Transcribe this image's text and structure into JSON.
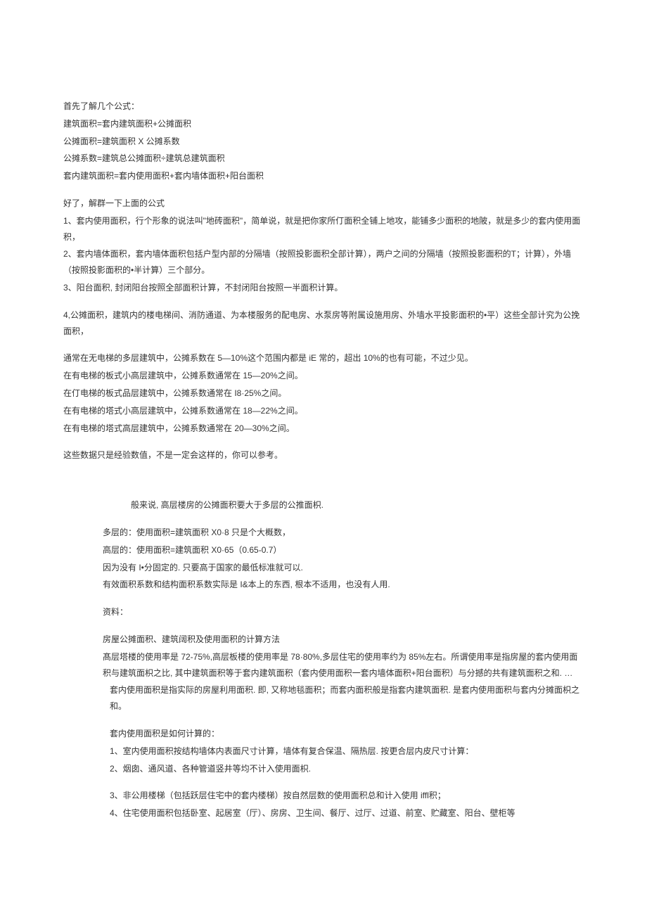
{
  "intro": {
    "line1": "首先了解几个公式：",
    "line2": "建筑面积=套内建筑面积+公摊面积",
    "line3": "公摊面积=建筑面积 X 公摊系数",
    "line4": "公摊系数=建筑总公摊面积÷建筑总建筑面积",
    "line5": "套内建筑面积=套内使用面积+套内墙体面积+阳台面积"
  },
  "explain": {
    "header": "好了，解群一下上面的公式",
    "item1": "1、套内使用面积，行个形象的说法叫\"地砖面积\"，简单说，就是把你家所仃面积全铺上地攻，能铺多少面积的地陂，就是多少的套内使用面积，",
    "item2": "2、套内墙体面积，套内墙体面积包括户型内部的分隔墙（按照投影面积全部计算），两户之间的分隔墙（按照投影面积的T；计算），外墙（按照投影面积的•半计算）三个部分。",
    "item3": "3、阳台面积, 封闭阳台按照全部面积计算，不封闭阳台按照一半面积计算。",
    "item4": "4,公摊面积，建筑内的楼电梯间、消防通道、为本楼服务的配电房、水泵房等附属设施用房、外墙水平投影面积的•平）这些全部计究为公挽面积，"
  },
  "ratios": {
    "r1": "通常在无电梯的多层建筑中，公摊系数在 5—10%这个范围内都是 iE 常的，超出 10%的也有可能，不过少见。",
    "r2": "在有电梯的板式小高层建筑中，公摊系数通常在 15—20%之间。",
    "r3": "在仃电梯的板式品层建筑中，公摊系数通常在 I8·25%之间。",
    "r4": "在有电梯的塔式小高层建筑中，公摊系数通常在 18—22%之间。",
    "r5": "在有电梯的塔式高层建筑中，公摊系数通常在 20—30%之间。",
    "note": "这些数据只是经验数值，不是一定会这样的，你可以参考。"
  },
  "middle": {
    "general": "般来说, 高层楼房的公摊面积要大于多层的公推面枳.",
    "multi": "多层的：使用面积=建筑面积 X0·8 只是个大概数，",
    "high": "高层的：使用面积=建筑面积 X0·65（0.65-0.7）",
    "reason": "因为没有 I•分固定的. 只要高于国家的最低标准就可以.",
    "coef": "有效面积系数和结构面积系数实际是 I&本上的东西, 根本不适用，也没有人用.",
    "ref": "资料："
  },
  "calc": {
    "title": "房屋公摊面积、建筑阔积及使用面积的计算方法",
    "p1": "髙层塔楼的使用率是 72-75%,高层板楼的使用率是 78·80%,多层住宅的使用率约为 85%左右。所谓使用率是指房屋的套内使用面积与建筑面枳之比, 其中建筑面积等于套内建筑面积（套内使用面积一套内墙体面积+阳台面积）与分撼的共有建筑面积之和. …",
    "p2": "套内使用面积是指实际的房屋利用面积. 即, 又称地毯面积；而套内面积般是指套内建筑面积. 是套内使用面积与套内分摊面枳之和。",
    "howTitle": "套内使用面积是如何计算的：",
    "how1": "1、室内使用面积按结构墙体内表面尺寸计算，墙体有复合保温、隔热层. 按更合层内皮尺寸计算：",
    "how2": "2、烟囱、通风道、各种管道竖井等均不计入使用面枳.",
    "how3": "3、非公用楼梯（包括跃层住宅中的套内楼梯）按自然层数的使用面积总和计入使用 iffl积；",
    "how4": "4、住宅使用面积包括卧室、起居室（厅）、房房、卫生间、餐厅、过厅、过道、前室、贮藏室、阳台、壁柜等"
  }
}
